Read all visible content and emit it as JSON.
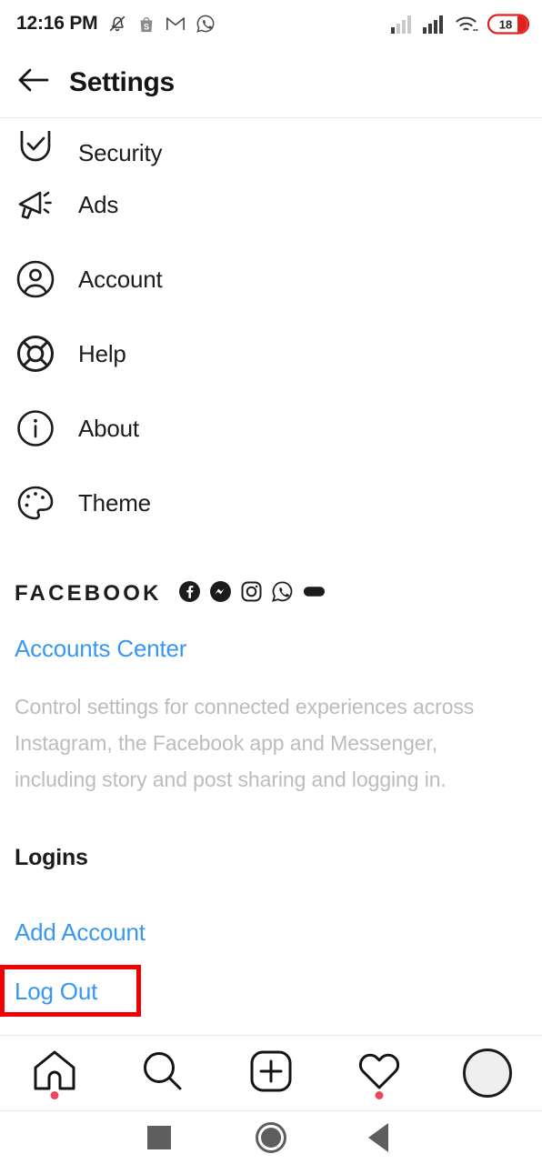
{
  "status_bar": {
    "time": "12:16 PM",
    "left_icons": [
      "bell-muted-icon",
      "shopee-icon",
      "gmail-icon",
      "whatsapp-icon"
    ],
    "right_icons": [
      "signal-1-icon",
      "signal-2-icon",
      "wifi-icon"
    ],
    "battery_level": "18",
    "battery_color": "#e02020"
  },
  "header": {
    "back_icon": "back-arrow-icon",
    "title": "Settings"
  },
  "settings_items": [
    {
      "label": "Security",
      "icon": "shield-check-icon"
    },
    {
      "label": "Ads",
      "icon": "megaphone-icon"
    },
    {
      "label": "Account",
      "icon": "person-circle-icon"
    },
    {
      "label": "Help",
      "icon": "life-ring-icon"
    },
    {
      "label": "About",
      "icon": "info-circle-icon"
    },
    {
      "label": "Theme",
      "icon": "palette-icon"
    }
  ],
  "facebook_section": {
    "heading": "FACEBOOK",
    "brand_icons": [
      "facebook-icon",
      "messenger-icon",
      "instagram-icon",
      "whatsapp-icon",
      "portal-icon"
    ],
    "link_label": "Accounts Center",
    "description": "Control settings for connected experiences across Instagram, the Facebook app and Messenger, including story and post sharing and logging in."
  },
  "logins_section": {
    "title": "Logins",
    "add_account_label": "Add Account",
    "log_out_label": "Log Out"
  },
  "tab_bar": {
    "tabs": [
      {
        "name": "home",
        "icon": "home-icon",
        "badge": true
      },
      {
        "name": "search",
        "icon": "search-icon",
        "badge": false
      },
      {
        "name": "create",
        "icon": "plus-square-icon",
        "badge": false
      },
      {
        "name": "activity",
        "icon": "heart-icon",
        "badge": true
      },
      {
        "name": "profile",
        "icon": "avatar-icon",
        "badge": false
      }
    ]
  },
  "android_nav": {
    "recents_icon": "square-icon",
    "home_icon": "circle-icon",
    "back_icon": "triangle-back-icon"
  },
  "colors": {
    "link_blue": "#3897f0",
    "highlight_red": "#f20000",
    "text_dark": "#1c1c1c",
    "text_muted": "#bcbcbc"
  }
}
